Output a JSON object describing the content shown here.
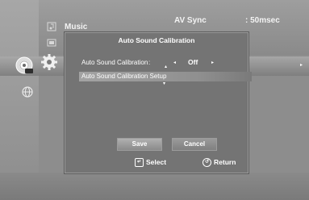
{
  "background_menu": {
    "music_label": "Music",
    "av_sync_label": "AV Sync",
    "av_sync_value": ": 50msec"
  },
  "dialog": {
    "title": "Auto Sound Calibration",
    "rows": [
      {
        "label": "Auto Sound Calibration",
        "separator": ":",
        "value": "Off"
      },
      {
        "label": "Auto Sound Calibration Setup"
      }
    ],
    "buttons": {
      "save": "Save",
      "cancel": "Cancel"
    }
  },
  "footer": {
    "select_label": "Select",
    "return_label": "Return"
  },
  "icons": [
    "music-note-icon",
    "photo-icon",
    "disc-icon",
    "gear-icon",
    "globe-icon",
    "select-key-icon",
    "return-key-icon"
  ]
}
